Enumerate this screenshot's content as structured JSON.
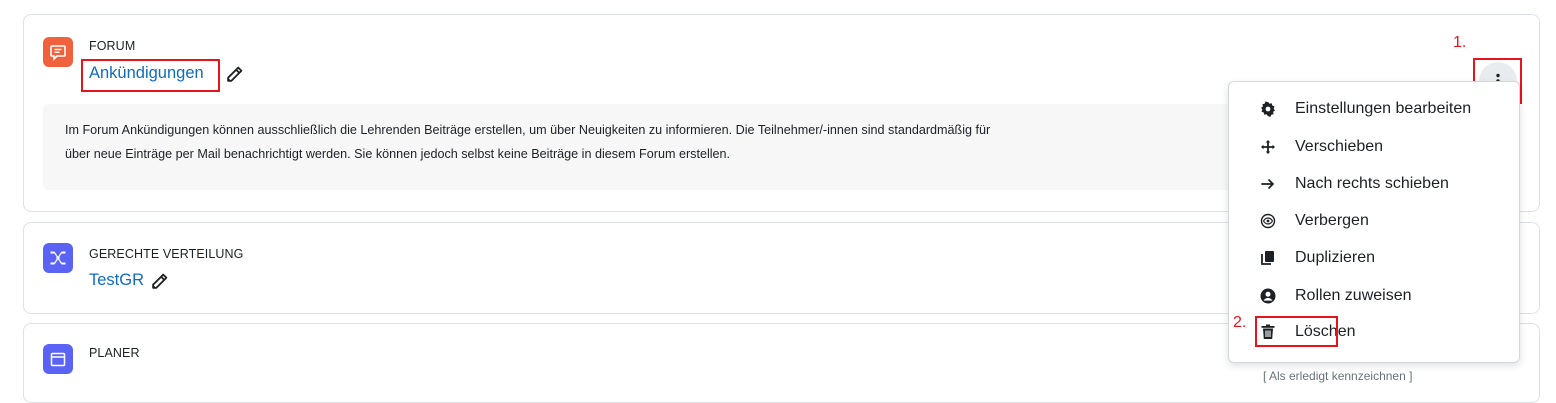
{
  "cards": {
    "forum": {
      "type": "FORUM",
      "title": "Ankündigungen",
      "description_line1": "Im Forum Ankündigungen können ausschließlich die Lehrenden Beiträge erstellen, um über Neuigkeiten zu informieren. Die Teilnehmer/-innen sind standardmäßig für",
      "description_line2": "über neue Einträge per Mail benachrichtigt werden. Sie können jedoch selbst keine Beiträge in diesem Forum erstellen.",
      "icon": "forum-speech-bubble-icon",
      "icon_color": "#f0623d"
    },
    "gerechte": {
      "type": "GERECHTE VERTEILUNG",
      "title": "TestGR",
      "icon": "distribution-network-icon",
      "icon_color": "#5b63f5"
    },
    "planer": {
      "type": "PLANER",
      "action_text": "[ Als erledigt kennzeichnen ]",
      "icon": "planner-calendar-icon",
      "icon_color": "#5b63f5"
    }
  },
  "annotations": {
    "step1": "1.",
    "step2": "2.",
    "highlight_color": "#e8141b"
  },
  "menu": {
    "items": [
      {
        "label": "Einstellungen bearbeiten",
        "icon": "gear-icon"
      },
      {
        "label": "Verschieben",
        "icon": "move-arrows-icon"
      },
      {
        "label": "Nach rechts schieben",
        "icon": "arrow-right-icon"
      },
      {
        "label": "Verbergen",
        "icon": "eye-icon"
      },
      {
        "label": "Duplizieren",
        "icon": "copy-icon"
      },
      {
        "label": "Rollen zuweisen",
        "icon": "user-circle-icon"
      },
      {
        "label": "Löschen",
        "icon": "trash-icon"
      }
    ]
  }
}
